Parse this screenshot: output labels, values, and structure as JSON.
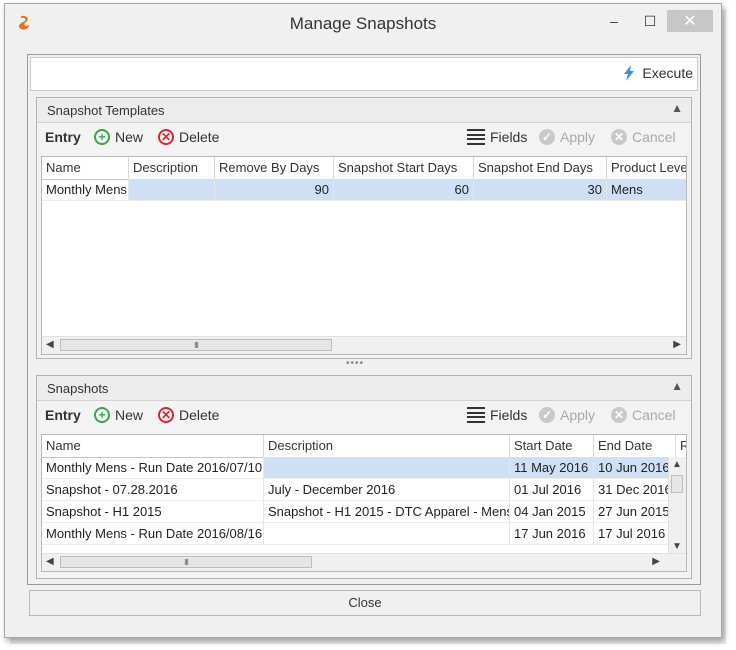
{
  "window": {
    "title": "Manage Snapshots",
    "buttons": {
      "minimize": "–",
      "maximize": "☐",
      "close": "✕"
    }
  },
  "toolbar": {
    "execute_label": "Execute"
  },
  "templates": {
    "title": "Snapshot Templates",
    "toolbar": {
      "entry": "Entry",
      "new": "New",
      "delete": "Delete",
      "fields": "Fields",
      "apply": "Apply",
      "cancel": "Cancel"
    },
    "columns": [
      "Name",
      "Description",
      "Remove By Days",
      "Snapshot Start Days",
      "Snapshot End Days",
      "Product Leve"
    ],
    "rows": [
      [
        "Monthly Mens",
        "",
        "90",
        "60",
        "30",
        "Mens"
      ]
    ]
  },
  "snapshots": {
    "title": "Snapshots",
    "toolbar": {
      "entry": "Entry",
      "new": "New",
      "delete": "Delete",
      "fields": "Fields",
      "apply": "Apply",
      "cancel": "Cancel"
    },
    "columns": [
      "Name",
      "Description",
      "Start Date",
      "End Date",
      "R"
    ],
    "rows": [
      [
        "Monthly Mens - Run Date 2016/07/10",
        "",
        "11 May 2016",
        "10 Jun 2016"
      ],
      [
        "Snapshot - 07.28.2016",
        "July - December 2016",
        "01 Jul 2016",
        "31 Dec 2016"
      ],
      [
        "Snapshot - H1 2015",
        "Snapshot - H1 2015 - DTC Apparel - Mens",
        "04 Jan 2015",
        "27 Jun 2015"
      ],
      [
        "Monthly Mens - Run Date 2016/08/16",
        "",
        "17 Jun 2016",
        "17 Jul 2016"
      ]
    ]
  },
  "footer": {
    "close_label": "Close"
  },
  "colors": {
    "selection": "#cfe0f4",
    "new_icon": "#3aa84a",
    "delete_icon": "#d9262c",
    "execute_icon": "#3b8fd9",
    "app_icon": "#f26a21"
  }
}
